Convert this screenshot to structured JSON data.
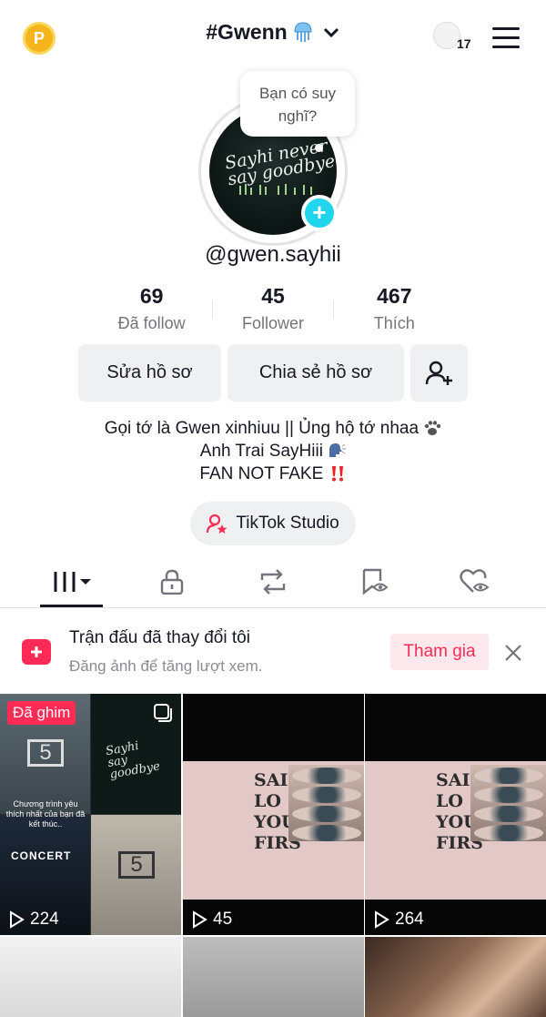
{
  "header": {
    "title": "#Gwenn",
    "notif_count": "17"
  },
  "avatar": {
    "thought": "Bạn có suy nghĩ?",
    "cover_text": "Sayhi never say goodbye"
  },
  "profile": {
    "username": "@gwen.sayhii"
  },
  "stats": [
    {
      "value": "69",
      "label": "Đã follow"
    },
    {
      "value": "45",
      "label": "Follower"
    },
    {
      "value": "467",
      "label": "Thích"
    }
  ],
  "buttons": {
    "edit": "Sửa hồ sơ",
    "share": "Chia sẻ hồ sơ"
  },
  "bio": {
    "line1": "Gọi tớ là Gwen xinhiuu || Ủng hộ tớ nhaa",
    "line2": "Anh Trai SayHiii",
    "line3": "FAN NOT FAKE"
  },
  "studio": {
    "label": "TikTok Studio"
  },
  "banner": {
    "title": "Trận đấu đã thay đổi tôi",
    "subtitle": "Đăng ảnh để tăng lượt xem.",
    "join": "Tham gia"
  },
  "videos": [
    {
      "views": "224",
      "pinned_label": "Đã ghim",
      "caption": "Chương trình yêu thích nhất của bạn đã kết thúc..",
      "concert_text": "CONCERT"
    },
    {
      "views": "45",
      "word_lines": [
        "SAI",
        "LO",
        "YOU",
        "FIRS"
      ]
    },
    {
      "views": "264",
      "word_lines": [
        "SAI",
        "LO",
        "YOU",
        "FIRS"
      ]
    }
  ],
  "colors": {
    "accent": "#fe2c55",
    "cyan": "#20d5ec",
    "coin": "#f6b51c"
  }
}
